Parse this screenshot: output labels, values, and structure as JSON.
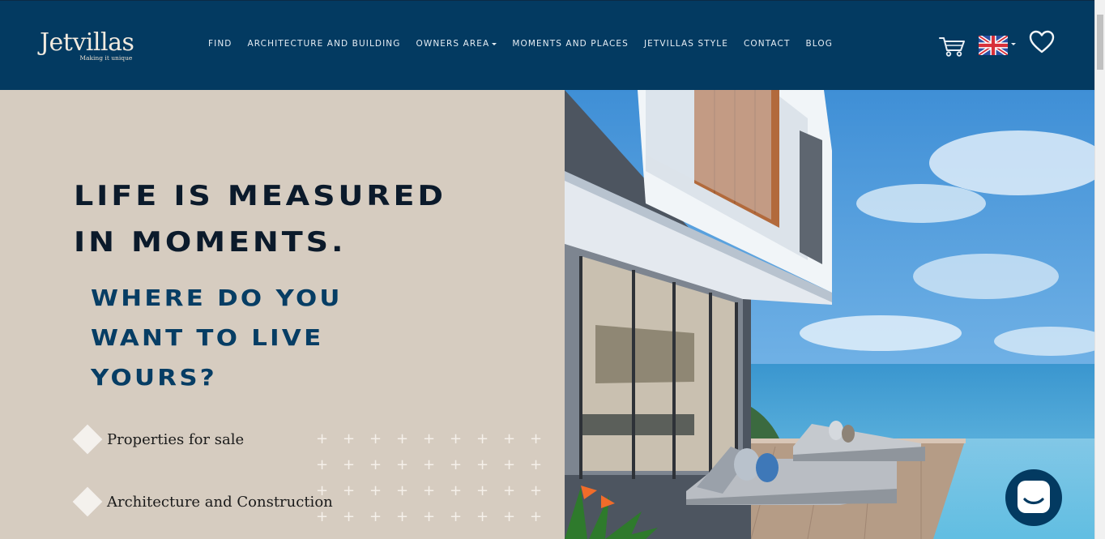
{
  "header": {
    "logo_name": "Jetvillas",
    "logo_tagline": "Making it unique",
    "nav": [
      {
        "label": "FIND",
        "dropdown": false
      },
      {
        "label": "ARCHITECTURE AND BUILDING",
        "dropdown": false
      },
      {
        "label": "OWNERS AREA",
        "dropdown": true
      },
      {
        "label": "MOMENTS AND PLACES",
        "dropdown": false
      },
      {
        "label": "JETVILLAS STYLE",
        "dropdown": false
      },
      {
        "label": "CONTACT",
        "dropdown": false
      },
      {
        "label": "BLOG",
        "dropdown": false
      }
    ],
    "icons": [
      "cart-icon",
      "uk-flag-icon",
      "heart-icon"
    ]
  },
  "hero": {
    "headline_line1": "LIFE IS MEASURED",
    "headline_line2": "IN MOMENTS.",
    "subhead_line1": "WHERE DO YOU",
    "subhead_line2": "WANT TO LIVE",
    "subhead_line3": "YOURS?",
    "links": [
      "Properties for sale",
      "Architecture and Construction"
    ]
  },
  "colors": {
    "header_bg": "#033a61",
    "hero_left_bg": "#d6ccc0",
    "headline": "#0b1a2b",
    "subhead": "#063d64",
    "chat_button": "#033a61"
  },
  "chat": {
    "icon": "chat-bubble-icon"
  }
}
